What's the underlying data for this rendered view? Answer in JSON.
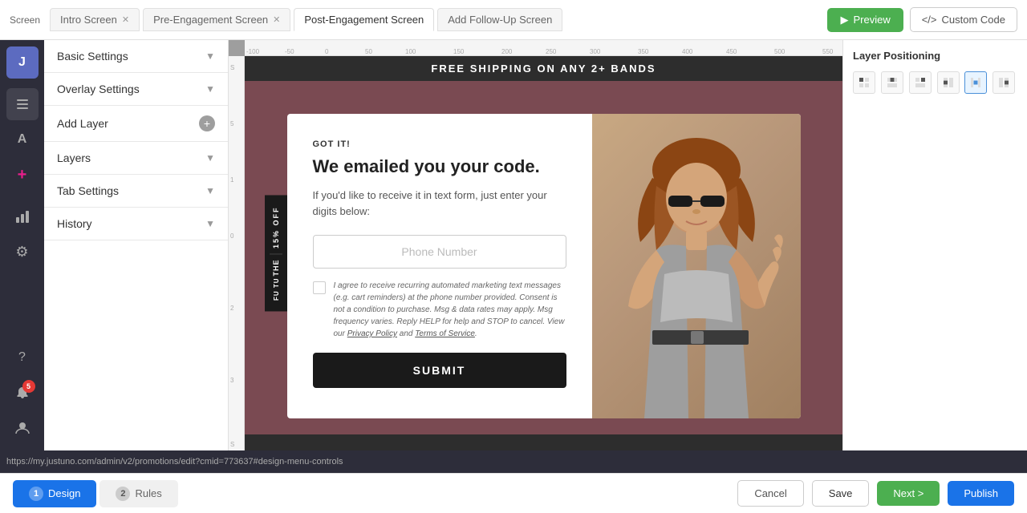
{
  "topBar": {
    "screenLabel": "Screen",
    "tabs": [
      {
        "id": "intro",
        "label": "Intro Screen",
        "active": false,
        "closable": true
      },
      {
        "id": "pre-engagement",
        "label": "Pre-Engagement Screen",
        "active": false,
        "closable": true
      },
      {
        "id": "post-engagement",
        "label": "Post-Engagement Screen",
        "active": true,
        "closable": false
      },
      {
        "id": "add-follow-up",
        "label": "Add Follow-Up Screen",
        "active": false,
        "closable": false
      }
    ],
    "previewBtn": "Preview",
    "customCodeBtn": "Custom Code"
  },
  "leftPanel": {
    "sections": [
      {
        "id": "basic-settings",
        "label": "Basic Settings",
        "expanded": false
      },
      {
        "id": "overlay-settings",
        "label": "Overlay Settings",
        "expanded": false
      },
      {
        "id": "add-layer",
        "label": "Add Layer",
        "isAdd": true
      },
      {
        "id": "layers",
        "label": "Layers",
        "expanded": false
      },
      {
        "id": "tab-settings",
        "label": "Tab Settings",
        "expanded": false
      },
      {
        "id": "history",
        "label": "History",
        "expanded": false
      }
    ]
  },
  "canvas": {
    "bannerText": "FREE SHIPPING ON ANY 2+ BANDS",
    "modal": {
      "tag": "GOT IT!",
      "title": "We emailed you your code.",
      "subtitle": "If you'd like to receive it in text form, just enter your digits below:",
      "phoneInputPlaceholder": "Phone Number",
      "consentText": "I agree to receive recurring automated marketing text messages (e.g. cart reminders) at the phone number provided. Consent is not a condition to purchase. Msg & data rates may apply. Msg frequency varies. Reply HELP for help and STOP to cancel. View our ",
      "privacyPolicy": "Privacy Policy",
      "and": " and ",
      "termsOfService": "Terms of Service",
      "submitBtn": "SUBMIT",
      "sideBadgeLines": [
        "15% OFF",
        "THE",
        "FU TU"
      ]
    }
  },
  "rightPanel": {
    "title": "Layer Positioning",
    "positionBtns": [
      "top-left",
      "top-center",
      "top-right",
      "align-left",
      "align-center",
      "align-right"
    ]
  },
  "bottomBar": {
    "tabs": [
      {
        "id": "design",
        "label": "Design",
        "num": "1",
        "active": true
      },
      {
        "id": "rules",
        "label": "Rules",
        "num": "2",
        "active": false
      }
    ],
    "cancelBtn": "Cancel",
    "saveBtn": "Save",
    "nextBtn": "Next >",
    "publishBtn": "Publish"
  },
  "urlBar": {
    "url": "https://my.justuno.com/admin/v2/promotions/edit?cmid=773637#design-menu-controls"
  },
  "sidebarIcons": [
    {
      "id": "logo",
      "icon": "J",
      "isLogo": true
    },
    {
      "id": "layers",
      "icon": "⊞"
    },
    {
      "id": "font",
      "icon": "A"
    },
    {
      "id": "plus",
      "icon": "+"
    },
    {
      "id": "analytics",
      "icon": "📊"
    },
    {
      "id": "settings",
      "icon": "⚙"
    },
    {
      "id": "help",
      "icon": "?"
    },
    {
      "id": "notifications",
      "icon": "🔔",
      "badge": "5"
    },
    {
      "id": "user",
      "icon": "👤"
    }
  ]
}
